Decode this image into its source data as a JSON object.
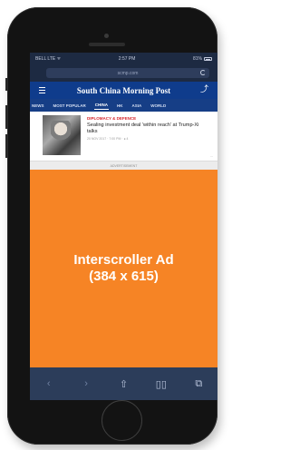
{
  "statusbar": {
    "carrier": "BELL LTE ᯤ",
    "time": "2:57 PM",
    "battery_pct": "81%"
  },
  "browser": {
    "url": "scmp.com"
  },
  "site": {
    "brand": "South China Morning Post",
    "share_icon": "share-icon"
  },
  "tabs": [
    "NEWS",
    "MOST POPULAR",
    "CHINA",
    "HK",
    "ASIA",
    "WORLD"
  ],
  "tabs_active_index": 2,
  "article": {
    "kicker": "DIPLOMACY & DEFENCE",
    "headline": "Sealing investment deal 'within reach' at Trump-Xi talks",
    "meta": "20 NOV 2017 · 7:00 PM · ● 4",
    "page_mark": "..."
  },
  "ad": {
    "label": "ADVERTISEMENT",
    "line1": "Interscroller Ad",
    "line2": "(384 x 615)",
    "color": "#f68425"
  },
  "toolbar": {
    "back": "‹",
    "forward": "›",
    "share": "⇧",
    "bookmarks": "▯▯",
    "tabs": "⧉"
  },
  "colors": {
    "brand_blue": "#0f3c8c",
    "chrome": "#1d2a42"
  }
}
